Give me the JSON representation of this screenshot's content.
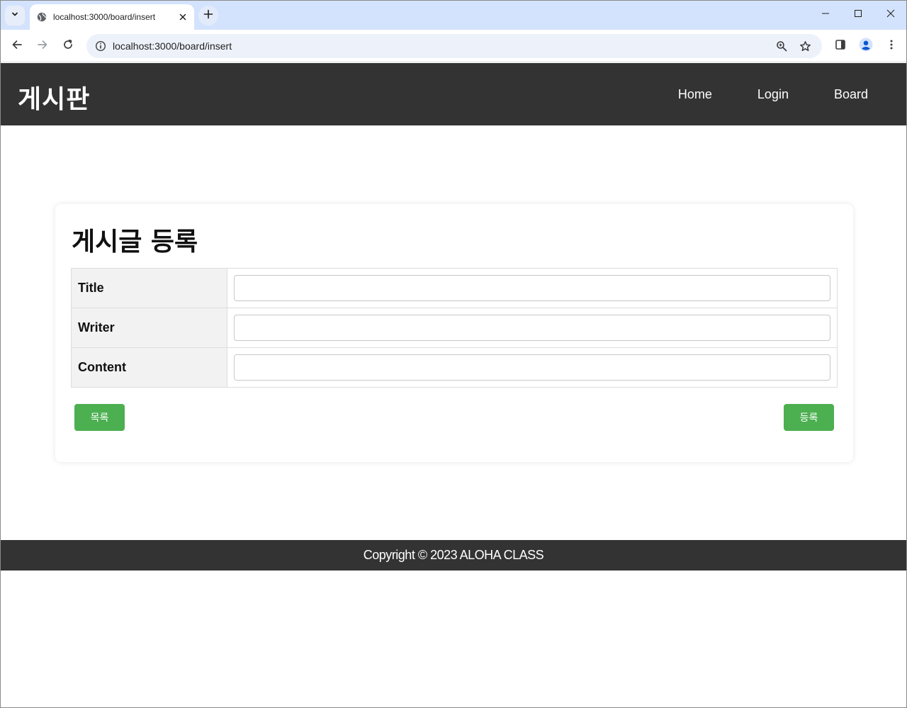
{
  "browser": {
    "tab_title": "localhost:3000/board/insert",
    "url": "localhost:3000/board/insert",
    "icons": {
      "tab_search": "chevron-down-icon",
      "favicon": "globe-icon",
      "tab_close": "close-icon",
      "new_tab": "plus-icon",
      "back": "arrow-left-icon",
      "forward": "arrow-right-icon",
      "reload": "reload-icon",
      "site_info": "info-icon",
      "zoom": "zoom-icon",
      "bookmark": "star-icon",
      "side_panel": "side-panel-icon",
      "profile": "profile-icon",
      "menu": "more-vert-icon",
      "minimize": "minimize-icon",
      "maximize": "maximize-icon",
      "close": "close-icon"
    },
    "colors": {
      "tabstrip": "#d3e3fd",
      "omnibox": "#edf2fa"
    }
  },
  "header": {
    "logo": "게시판",
    "nav": [
      "Home",
      "Login",
      "Board"
    ]
  },
  "form": {
    "title": "게시글 등록",
    "fields": [
      {
        "label": "Title",
        "value": ""
      },
      {
        "label": "Writer",
        "value": ""
      },
      {
        "label": "Content",
        "value": ""
      }
    ],
    "list_button": "목록",
    "submit_button": "등록"
  },
  "footer": {
    "text": "Copyright © 2023 ALOHA CLASS"
  },
  "colors": {
    "header_bg": "#333333",
    "button": "#4caf50",
    "label_bg": "#f2f2f2"
  }
}
